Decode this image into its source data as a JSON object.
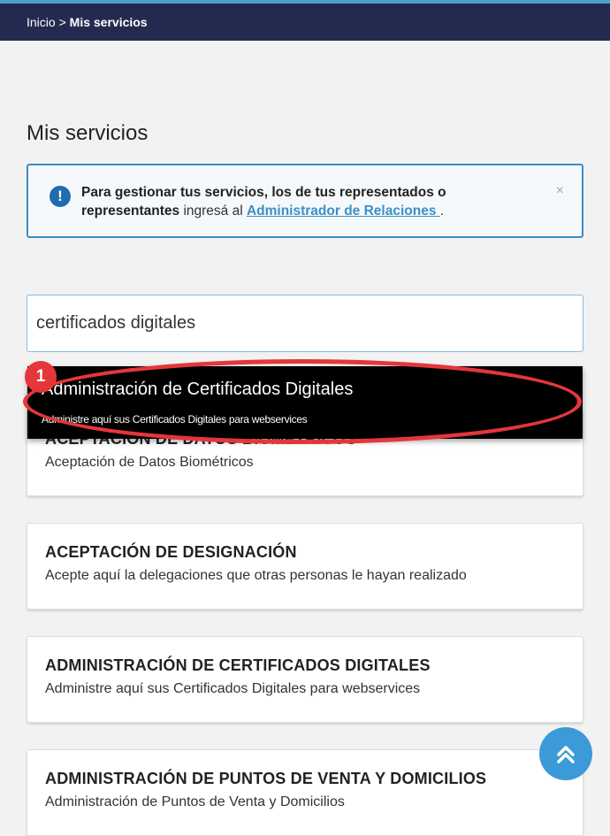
{
  "breadcrumb": {
    "home": "Inicio",
    "separator": ">",
    "current": "Mis servicios"
  },
  "page": {
    "title": "Mis servicios"
  },
  "alert": {
    "bold_text": "Para gestionar tus servicios, los de tus representados o representantes",
    "mid_text": " ingresá al ",
    "link_text": "Administrador de Relaciones ",
    "end_text": ".",
    "close": "×",
    "icon": "exclamation-circle-icon"
  },
  "search": {
    "value": "certificados digitales"
  },
  "dropdown": {
    "title": "Administración de Certificados Digitales",
    "description": "Administre aquí sus Certificados Digitales para webservices"
  },
  "annotation": {
    "badge": "1",
    "color": "#e5363a"
  },
  "services": [
    {
      "title": "ACEPTACIÓN DE DATOS BIOMÉTRICOS",
      "description": "Aceptación de Datos Biométricos"
    },
    {
      "title": "ACEPTACIÓN DE DESIGNACIÓN",
      "description": "Acepte aquí la delegaciones que otras personas le hayan realizado"
    },
    {
      "title": "ADMINISTRACIÓN DE CERTIFICADOS DIGITALES",
      "description": "Administre aquí sus Certificados Digitales para webservices"
    },
    {
      "title": "ADMINISTRACIÓN DE PUNTOS DE VENTA Y DOMICILIOS",
      "description": "Administración de Puntos de Venta y Domicilios"
    }
  ],
  "scroll_top": {
    "icon": "double-chevron-up-icon"
  },
  "colors": {
    "topbar": "#242a4f",
    "accent": "#3b8fc4",
    "scroll_button": "#3d9ad8"
  }
}
